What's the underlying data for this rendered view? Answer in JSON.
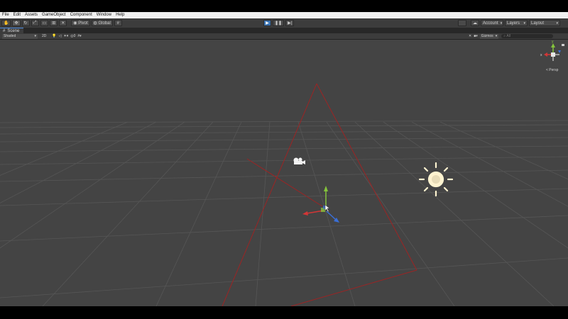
{
  "menu": [
    "File",
    "Edit",
    "Assets",
    "GameObject",
    "Component",
    "Window",
    "Help"
  ],
  "toolbar": {
    "tools": [
      "hand-tool",
      "move-tool",
      "rotate-tool",
      "scale-tool",
      "rect-tool",
      "transform-tool",
      "custom-tool"
    ],
    "pivot_label": "Pivot",
    "global_label": "Global",
    "account_label": "Account",
    "layers_label": "Layers",
    "layout_label": "Layout"
  },
  "tab": {
    "label": "Scene"
  },
  "scene_toolbar": {
    "shading": "Shaded",
    "mode_2d": "2D",
    "gizmos_label": "Gizmos",
    "search_placeholder": "All"
  },
  "gizmo": {
    "projection_label": "< Persp"
  },
  "colors": {
    "background": "#444444",
    "grid": "#5b5b5b",
    "frustum": "#a02020",
    "axis_x": "#d33636",
    "axis_y": "#84c33c",
    "axis_z": "#3a6fd8",
    "light": "#fff3d0"
  }
}
